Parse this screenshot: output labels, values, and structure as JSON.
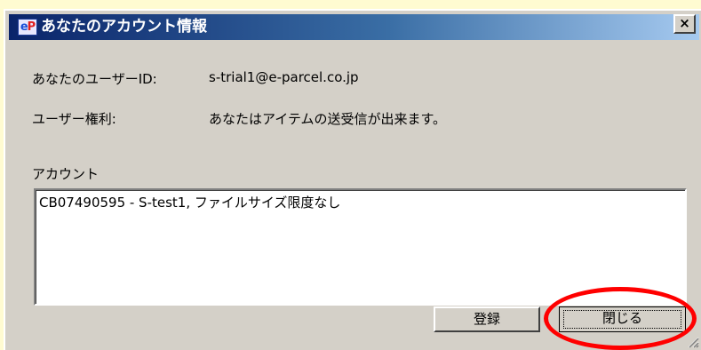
{
  "dialog": {
    "title": "あなたのアカウント情報",
    "close_glyph": "×"
  },
  "info": {
    "user_id_label": "あなたのユーザーID:",
    "user_id_value": "s-trial1@e-parcel.co.jp",
    "rights_label": "ユーザー権利:",
    "rights_value": "あなたはアイテムの送受信が出来ます。"
  },
  "account": {
    "label": "アカウント",
    "items": [
      "CB07490595 - S-test1, ファイルサイズ限度なし"
    ]
  },
  "buttons": {
    "register": "登録",
    "close": "閉じる"
  },
  "colors": {
    "title_gradient_start": "#0a246a",
    "title_gradient_end": "#a6caf0",
    "dialog_face": "#d4d0c8",
    "background": "#fffbd1",
    "annotation": "#ff0000"
  }
}
